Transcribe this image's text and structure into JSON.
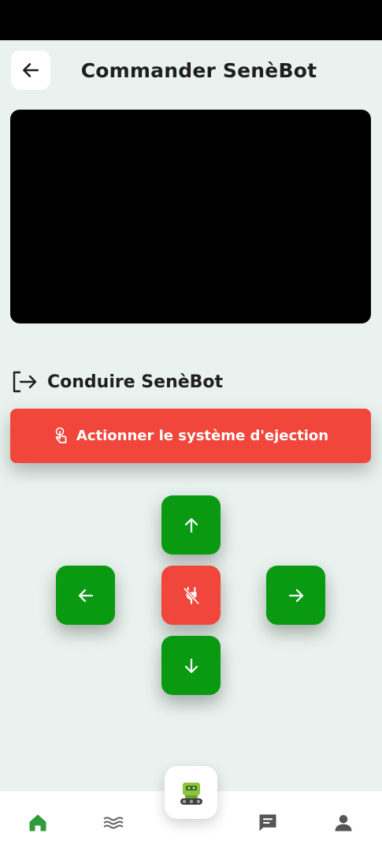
{
  "header": {
    "title": "Commander SenèBot",
    "back_icon": "arrow-left-icon"
  },
  "video": {
    "state": "black/empty feed"
  },
  "drive_section": {
    "title": "Conduire SenèBot",
    "icon": "exit-arrow-icon"
  },
  "eject_button": {
    "label": "Actionner le système d'ejection",
    "icon": "touch-hand-icon",
    "color": "#f0463b"
  },
  "controls": {
    "up_icon": "arrow-up-icon",
    "down_icon": "arrow-down-icon",
    "left_icon": "arrow-left-icon",
    "right_icon": "arrow-right-icon",
    "stop_icon": "power-off-icon",
    "move_color": "#0a9a12",
    "stop_color": "#f0463b"
  },
  "bottom_nav": {
    "items": [
      {
        "icon": "home-icon",
        "active": true
      },
      {
        "icon": "waves-icon",
        "active": false
      },
      {
        "icon": "robot-icon",
        "active": false
      },
      {
        "icon": "chat-icon",
        "active": false
      },
      {
        "icon": "user-icon",
        "active": false
      }
    ],
    "active_color": "#2f9b3a",
    "inactive_color": "#666666"
  }
}
